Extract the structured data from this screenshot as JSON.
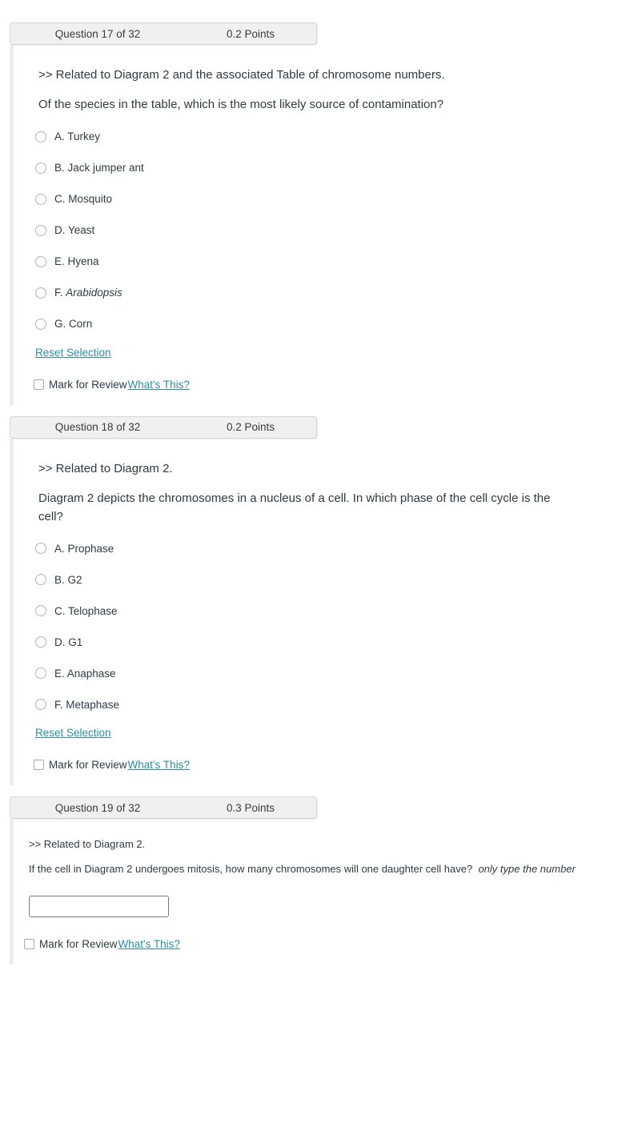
{
  "questions": [
    {
      "header": {
        "name": "Question 17 of 32",
        "points": "0.2 Points"
      },
      "prompt_lead": ">> Related to Diagram 2 and the associated Table of chromosome numbers.",
      "prompt_body": "Of the species in the table, which is the most likely source of contamination?",
      "options": [
        {
          "label": "A. Turkey",
          "italic": false
        },
        {
          "label": "B. Jack jumper ant",
          "italic": false
        },
        {
          "label": "C. Mosquito",
          "italic": false
        },
        {
          "label": "D. Yeast",
          "italic": false
        },
        {
          "label": "E. Hyena",
          "italic": false
        },
        {
          "label": "F. Arabidopsis",
          "italic": true,
          "prefix": "F. ",
          "italic_part": "Arabidopsis"
        },
        {
          "label": "G. Corn",
          "italic": false
        }
      ],
      "reset_label": "Reset Selection",
      "review_label": "Mark for Review",
      "whats_this_label": "What's This?"
    },
    {
      "header": {
        "name": "Question 18 of 32",
        "points": "0.2 Points"
      },
      "prompt_lead": ">> Related to Diagram 2.",
      "prompt_body": "Diagram 2 depicts the chromosomes in a nucleus of a cell. In which phase of the cell cycle is the cell?",
      "options": [
        {
          "label": "A. Prophase",
          "italic": false
        },
        {
          "label": "B. G2",
          "italic": false
        },
        {
          "label": "C. Telophase",
          "italic": false
        },
        {
          "label": "D. G1",
          "italic": false
        },
        {
          "label": "E. Anaphase",
          "italic": false
        },
        {
          "label": "F. Metaphase",
          "italic": false
        }
      ],
      "reset_label": "Reset Selection",
      "review_label": "Mark for Review",
      "whats_this_label": "What's This?"
    },
    {
      "header": {
        "name": "Question 19 of 32",
        "points": "0.3 Points"
      },
      "prompt_lead": ">> Related to Diagram 2.",
      "prompt_body_plain": "If the cell in Diagram 2 undergoes mitosis, how many chromosomes will one daughter cell have?",
      "prompt_body_italic": "only type the number",
      "answer_value": "",
      "answer_placeholder": "",
      "review_label": "Mark for Review",
      "whats_this_label": "What's This?"
    }
  ],
  "colors": {
    "link": "#2b8ea6",
    "text": "#2d3b45",
    "header_bg": "#f0f0f0",
    "rail": "#ececec"
  }
}
